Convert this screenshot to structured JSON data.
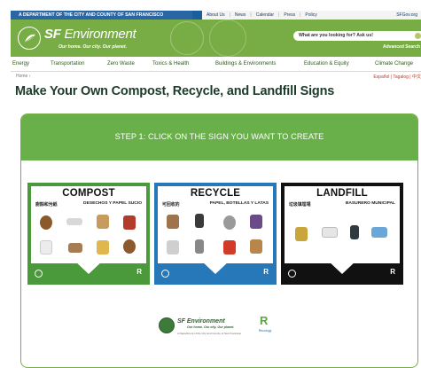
{
  "topbar": {
    "dept": "A DEPARTMENT OF THE CITY AND COUNTY OF SAN FRANCISCO",
    "links": [
      "About Us",
      "News",
      "Calendar",
      "Press",
      "Policy"
    ],
    "sfgov": "SFGov.org"
  },
  "header": {
    "brand_bold": "SF",
    "brand_rest": "Environment",
    "tagline": "Our home. Our city. Our planet.",
    "search_placeholder": "What are you looking for? Ask us!",
    "advanced_search": "Advanced Search"
  },
  "nav": {
    "items": [
      "Energy",
      "Transportation",
      "Zero Waste",
      "Toxics & Health",
      "Buildings & Environments",
      "Education & Equity",
      "Climate Change"
    ]
  },
  "breadcrumb": {
    "home": "Home ›"
  },
  "languages": "Español | Tagalog | 中文",
  "page_title": "Make Your Own Compost, Recycle, and Landfill Signs",
  "step_label": "STEP 1: CLICK ON THE SIGN YOU WANT TO CREATE",
  "signs": [
    {
      "title": "COMPOST",
      "sub_cn": "廚餘和污紙",
      "sub_es": "DESECHOS Y PAPEL SUCIO",
      "color": "#4a9a3b"
    },
    {
      "title": "RECYCLE",
      "sub_cn": "可回收的",
      "sub_es": "PAPEL, BOTELLAS Y LATAS",
      "color": "#2678b8"
    },
    {
      "title": "LANDFILL",
      "sub_cn": "垃圾填埋場",
      "sub_es": "BASURERO MUNICIPAL",
      "color": "#111111"
    }
  ],
  "footer_logos": {
    "brand": "SF Environment",
    "tagline": "Our home. Our city. Our planet.",
    "sub": "A Department of the City and County of San Francisco",
    "recology_r": "R",
    "recology_text": "Recology"
  },
  "colors": {
    "header_green": "#78ad45",
    "step_green": "#69b04a",
    "topbar_blue": "#1b5e9b",
    "title_dark": "#1d3b2a"
  }
}
